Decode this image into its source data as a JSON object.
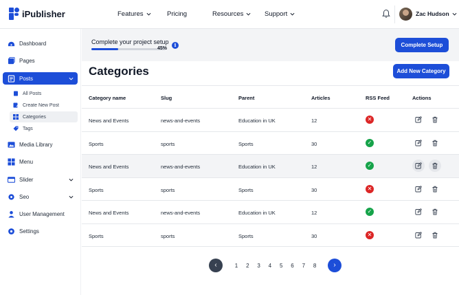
{
  "app": {
    "name": "iPublisher"
  },
  "topnav": {
    "items": [
      {
        "label": "Features",
        "has_dropdown": true
      },
      {
        "label": "Pricing",
        "has_dropdown": false
      },
      {
        "label": "Resources",
        "has_dropdown": true
      },
      {
        "label": "Support",
        "has_dropdown": true
      }
    ],
    "user": {
      "name": "Zac Hudson"
    }
  },
  "sidebar": {
    "items": [
      {
        "label": "Dashboard",
        "icon": "dashboard-icon"
      },
      {
        "label": "Pages",
        "icon": "pages-icon"
      },
      {
        "label": "Posts",
        "icon": "posts-icon",
        "active": true,
        "expanded": true
      },
      {
        "label": "Media Library",
        "icon": "media-icon"
      },
      {
        "label": "Menu",
        "icon": "menu-grid-icon"
      },
      {
        "label": "Slider",
        "icon": "slider-icon",
        "has_dropdown": true
      },
      {
        "label": "Seo",
        "icon": "seo-gear-icon",
        "has_dropdown": true
      },
      {
        "label": "User Management",
        "icon": "user-icon"
      },
      {
        "label": "Settings",
        "icon": "settings-icon"
      }
    ],
    "posts_sub": [
      {
        "label": "All Posts",
        "icon": "document-icon"
      },
      {
        "label": "Create New Post",
        "icon": "edit-document-icon"
      },
      {
        "label": "Categories",
        "icon": "categories-icon",
        "active": true
      },
      {
        "label": "Tags",
        "icon": "tag-icon"
      }
    ]
  },
  "setup": {
    "title": "Complete your project setup",
    "progress_percent": 45,
    "progress_label": "45%",
    "button": "Complete Setup"
  },
  "page": {
    "title": "Categories",
    "add_button": "Add New Category"
  },
  "table": {
    "columns": [
      "Category name",
      "Slug",
      "Parent",
      "Articles",
      "RSS Feed",
      "Actions"
    ],
    "rows": [
      {
        "name": "News and Events",
        "slug": "news-and-events",
        "parent": "Education in UK",
        "articles": "12",
        "rss": false
      },
      {
        "name": "Sports",
        "slug": "sports",
        "parent": "Sports",
        "articles": "30",
        "rss": true
      },
      {
        "name": "News and Events",
        "slug": "news-and-events",
        "parent": "Education in UK",
        "articles": "12",
        "rss": true
      },
      {
        "name": "Sports",
        "slug": "sports",
        "parent": "Sports",
        "articles": "30",
        "rss": false
      },
      {
        "name": "News and Events",
        "slug": "news-and-events",
        "parent": "Education in UK",
        "articles": "12",
        "rss": true
      },
      {
        "name": "Sports",
        "slug": "sports",
        "parent": "Sports",
        "articles": "30",
        "rss": false
      }
    ],
    "highlighted_row": 2
  },
  "pagination": {
    "pages": [
      "1",
      "2",
      "3",
      "4",
      "5",
      "6",
      "7",
      "8"
    ],
    "prev_glyph": "‹",
    "next_glyph": "›"
  },
  "colors": {
    "accent": "#1d4ed8",
    "rss_on": "#16a34a",
    "rss_off": "#dc2626"
  }
}
